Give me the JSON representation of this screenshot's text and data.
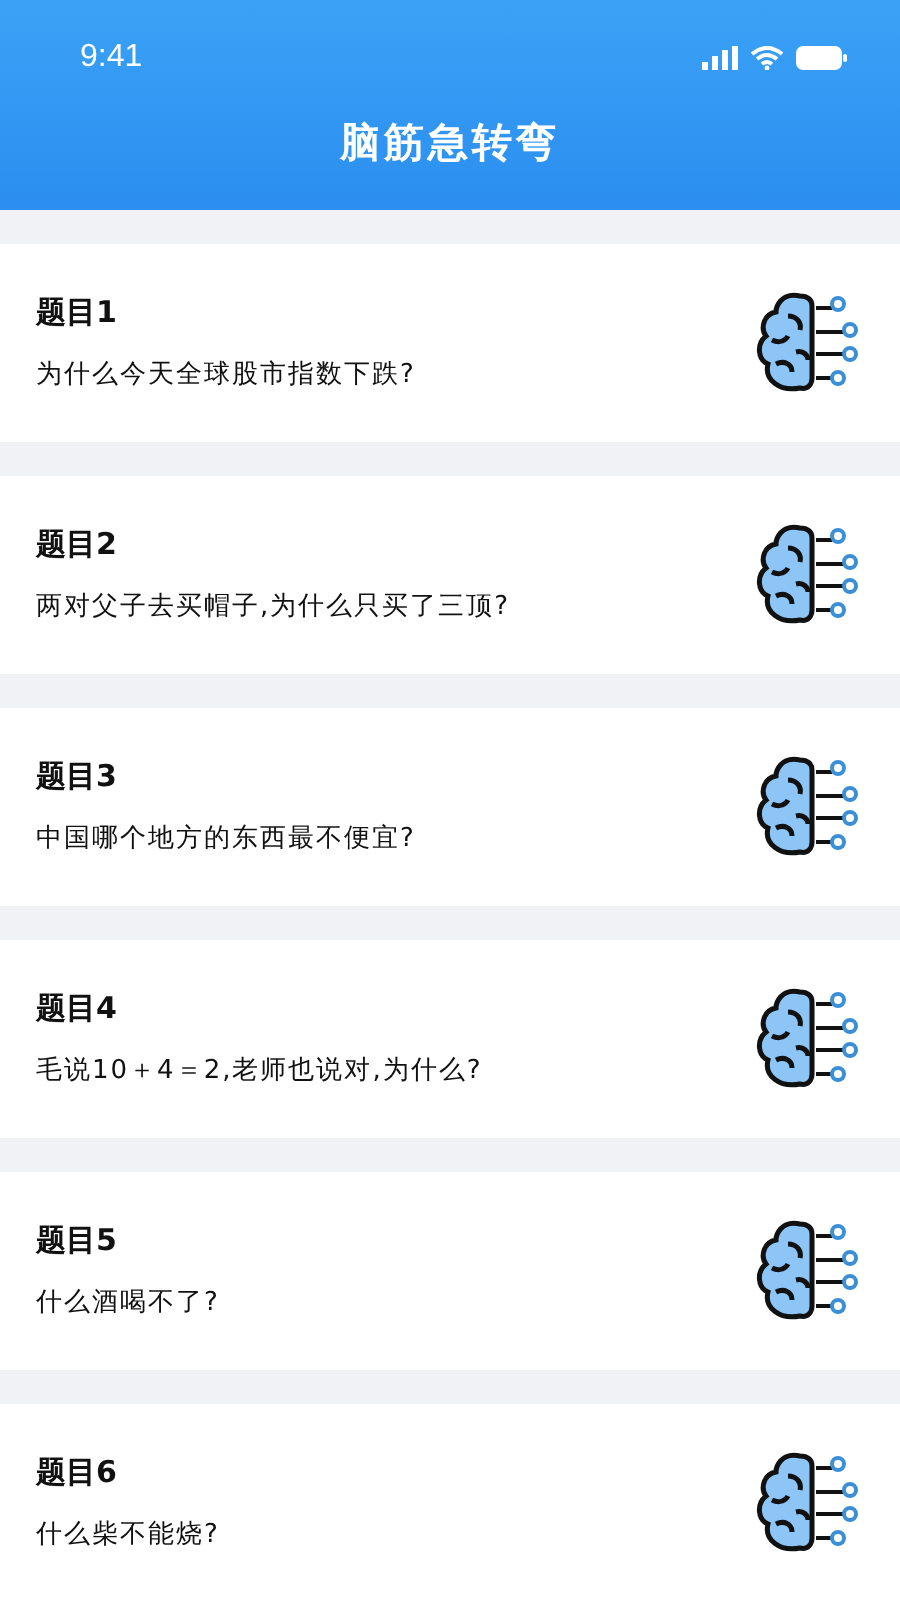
{
  "status_bar": {
    "time": "9:41"
  },
  "header": {
    "title": "脑筋急转弯"
  },
  "questions": [
    {
      "title": "题目1",
      "text": "为什么今天全球股市指数下跌?"
    },
    {
      "title": "题目2",
      "text": "两对父子去买帽子,为什么只买了三顶?"
    },
    {
      "title": "题目3",
      "text": "中国哪个地方的东西最不便宜?"
    },
    {
      "title": "题目4",
      "text": "毛说10＋4＝2,老师也说对,为什么?"
    },
    {
      "title": "题目5",
      "text": "什么酒喝不了?"
    },
    {
      "title": "题目6",
      "text": "什么柴不能烧?"
    }
  ]
}
